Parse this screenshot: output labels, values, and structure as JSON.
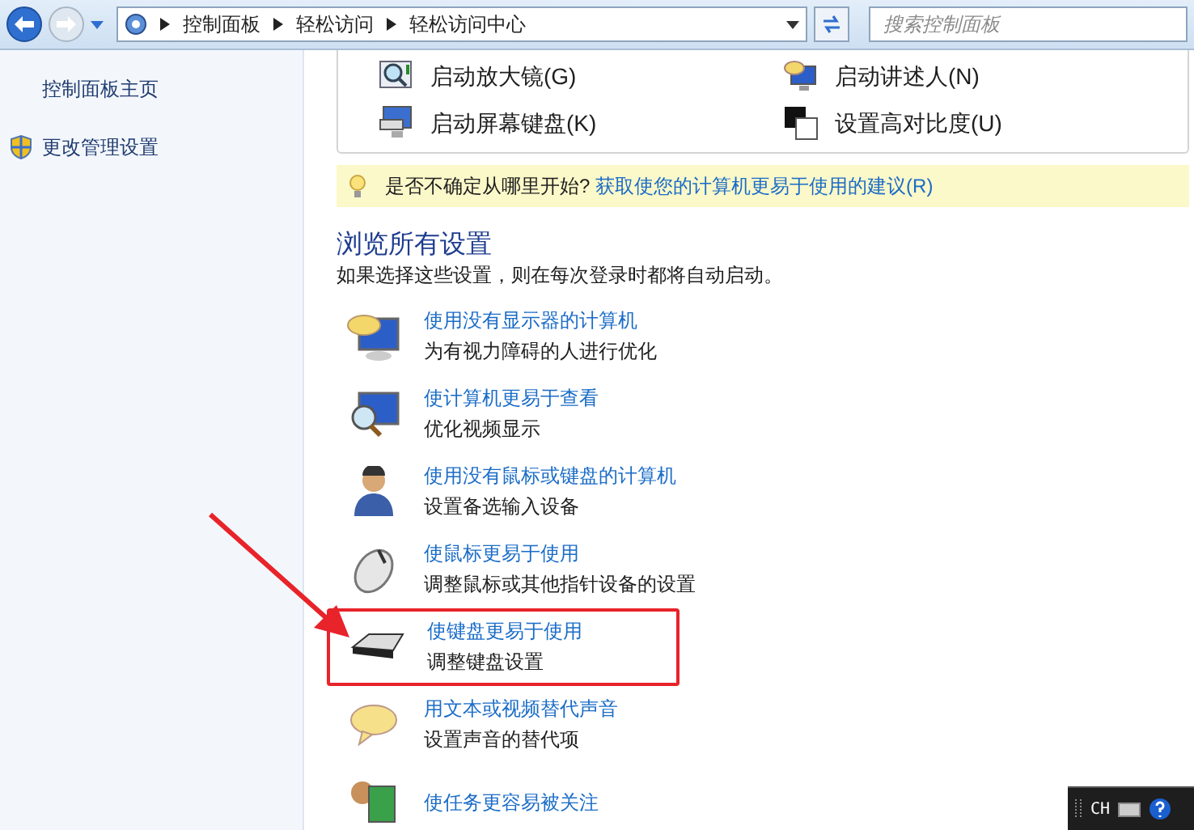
{
  "nav": {
    "breadcrumbs": [
      "控制面板",
      "轻松访问",
      "轻松访问中心"
    ],
    "search": {
      "placeholder": "搜索控制面板"
    }
  },
  "sidebar": {
    "items": [
      {
        "label": "控制面板主页",
        "kind": "link"
      },
      {
        "label": "更改管理设置",
        "kind": "shield"
      }
    ]
  },
  "quick_access": [
    {
      "label": "启动放大镜(G)",
      "kind": "magnifier"
    },
    {
      "label": "启动讲述人(N)",
      "kind": "narrator"
    },
    {
      "label": "启动屏幕键盘(K)",
      "kind": "screen-keyboard"
    },
    {
      "label": "设置高对比度(U)",
      "kind": "contrast"
    }
  ],
  "tip": {
    "question": "是否不确定从哪里开始?",
    "link": "获取使您的计算机更易于使用的建议(R)"
  },
  "browse": {
    "title": "浏览所有设置",
    "subtitle": "如果选择这些设置，则在每次登录时都将自动启动。",
    "items": [
      {
        "title": "使用没有显示器的计算机",
        "description": "为有视力障碍的人进行优化",
        "kind": "speech-monitor",
        "highlighted": false
      },
      {
        "title": "使计算机更易于查看",
        "description": "优化视频显示",
        "kind": "zoom-monitor",
        "highlighted": false
      },
      {
        "title": "使用没有鼠标或键盘的计算机",
        "description": "设置备选输入设备",
        "kind": "person",
        "highlighted": false
      },
      {
        "title": "使鼠标更易于使用",
        "description": "调整鼠标或其他指针设备的设置",
        "kind": "mouse",
        "highlighted": false
      },
      {
        "title": "使键盘更易于使用",
        "description": "调整键盘设置",
        "kind": "keyboard",
        "highlighted": true
      },
      {
        "title": "用文本或视频替代声音",
        "description": "设置声音的替代项",
        "kind": "speech",
        "highlighted": false
      },
      {
        "title": "使任务更容易被关注",
        "kind": "task",
        "highlighted": false
      }
    ]
  },
  "language_bar": {
    "label": "CH"
  }
}
